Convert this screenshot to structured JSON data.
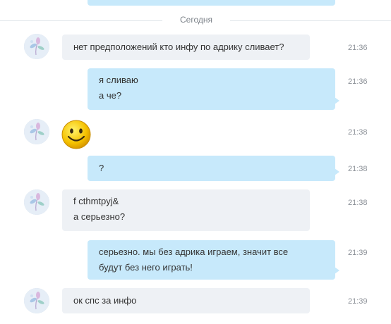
{
  "day_separator": "Сегодня",
  "messages": [
    {
      "direction": "incoming",
      "lines": [
        "нет предположений кто инфу по адрику сливает?"
      ],
      "time": "21:36"
    },
    {
      "direction": "outgoing",
      "lines": [
        "я сливаю",
        "а че?"
      ],
      "time": "21:36"
    },
    {
      "direction": "incoming",
      "emoji": "smiley-emoji",
      "time": "21:38"
    },
    {
      "direction": "outgoing",
      "lines": [
        "?"
      ],
      "time": "21:38"
    },
    {
      "direction": "incoming",
      "lines": [
        "f cthmtpyj&",
        "а серьезно?"
      ],
      "time": "21:38"
    },
    {
      "direction": "outgoing",
      "lines": [
        "серьезно. мы без адрика играем, значит все",
        "будут без него играть!"
      ],
      "time": "21:39"
    },
    {
      "direction": "incoming",
      "lines": [
        "ок спс за инфо"
      ],
      "time": "21:39"
    }
  ],
  "colors": {
    "incoming_bubble": "#eef1f5",
    "outgoing_bubble": "#c7e9fb",
    "time_text": "#8a8f96"
  }
}
